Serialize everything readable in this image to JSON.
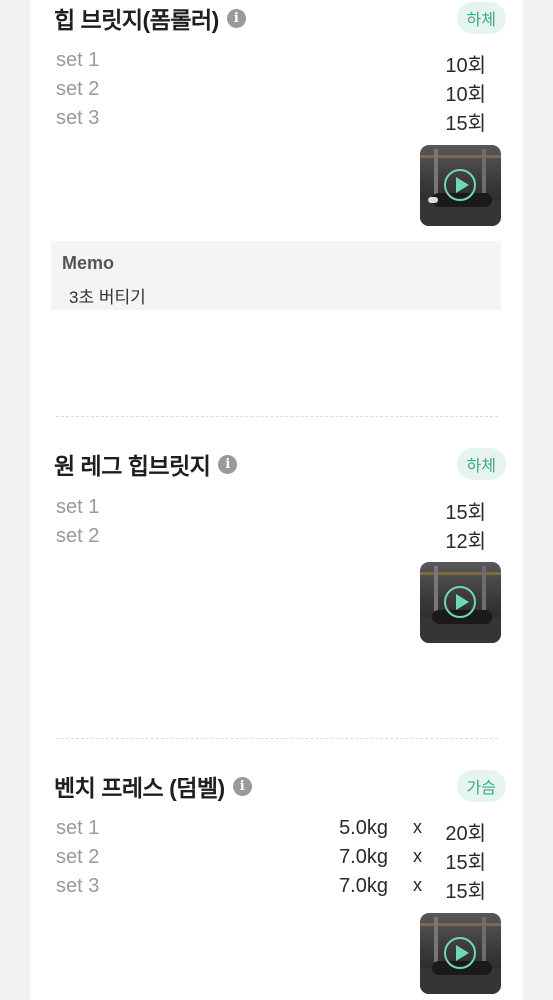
{
  "exercises": [
    {
      "title": "힙 브릿지(폼롤러)",
      "tag": "하체",
      "sets": [
        {
          "label": "set 1",
          "reps": "10회"
        },
        {
          "label": "set 2",
          "reps": "10회"
        },
        {
          "label": "set 3",
          "reps": "15회"
        }
      ],
      "memo": {
        "title": "Memo",
        "text": "3초 버티기"
      }
    },
    {
      "title": "원 레그 힙브릿지",
      "tag": "하체",
      "sets": [
        {
          "label": "set 1",
          "reps": "15회"
        },
        {
          "label": "set 2",
          "reps": "12회"
        }
      ]
    },
    {
      "title": "벤치 프레스 (덤벨)",
      "tag": "가슴",
      "sets": [
        {
          "label": "set 1",
          "weight": "5.0kg",
          "x": "x",
          "reps": "20회"
        },
        {
          "label": "set 2",
          "weight": "7.0kg",
          "x": "x",
          "reps": "15회"
        },
        {
          "label": "set 3",
          "weight": "7.0kg",
          "x": "x",
          "reps": "15회"
        }
      ]
    }
  ],
  "icons": {
    "info": "info-icon",
    "play": "play-icon"
  },
  "colors": {
    "accent": "#3aa98a",
    "badge_bg": "#e5f4ef"
  }
}
